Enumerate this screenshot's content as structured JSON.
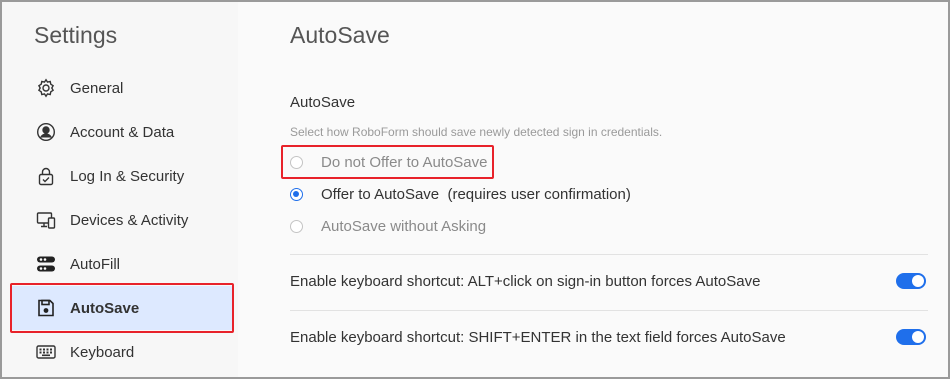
{
  "sidebar": {
    "title": "Settings",
    "items": [
      {
        "label": "General",
        "icon": "gear-icon"
      },
      {
        "label": "Account & Data",
        "icon": "user-circle-icon"
      },
      {
        "label": "Log In & Security",
        "icon": "lock-check-icon"
      },
      {
        "label": "Devices & Activity",
        "icon": "devices-icon"
      },
      {
        "label": "AutoFill",
        "icon": "autofill-icon"
      },
      {
        "label": "AutoSave",
        "icon": "floppy-disk-icon",
        "active": true
      },
      {
        "label": "Keyboard",
        "icon": "keyboard-icon"
      }
    ]
  },
  "main": {
    "title": "AutoSave",
    "section_title": "AutoSave",
    "section_desc": "Select how RoboForm should save newly detected sign in credentials.",
    "options": [
      {
        "label": "Do not Offer to AutoSave",
        "checked": false
      },
      {
        "label": "Offer to AutoSave  (requires user confirmation)",
        "checked": true
      },
      {
        "label": "AutoSave without Asking",
        "checked": false
      }
    ],
    "settings": [
      {
        "label": "Enable keyboard shortcut: ALT+click on sign-in button forces AutoSave",
        "on": true
      },
      {
        "label": "Enable keyboard shortcut: SHIFT+ENTER in the text field forces AutoSave",
        "on": true
      }
    ]
  },
  "colors": {
    "accent": "#1f6feb",
    "highlight": "#e8222a",
    "active_bg": "#dde9ff"
  }
}
